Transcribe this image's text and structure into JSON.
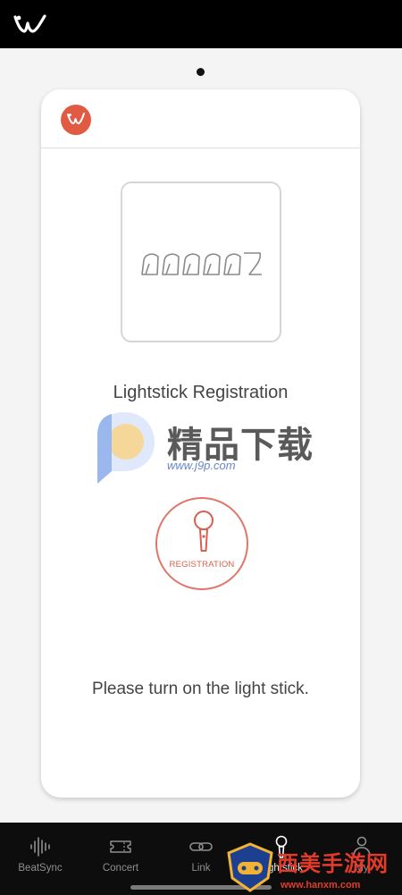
{
  "header": {
    "logo_icon": "weverse-logo-icon"
  },
  "card": {
    "title": "Lightstick Registration",
    "artist_logo_text": "ccccdz",
    "registration_button_label": "REGISTRATION",
    "hint": "Please turn on the light stick."
  },
  "watermark": {
    "text": "精品下载",
    "url": "www.j9p.com"
  },
  "corner_watermark": {
    "text": "西美手游网",
    "url": "www.hanxm.com"
  },
  "bottom_nav": [
    {
      "label": "BeatSync",
      "icon": "soundwave-icon"
    },
    {
      "label": "Concert",
      "icon": "ticket-icon"
    },
    {
      "label": "Link",
      "icon": "link-icon"
    },
    {
      "label": "Lightstick",
      "icon": "lightstick-icon"
    },
    {
      "label": "My",
      "icon": "person-icon"
    }
  ],
  "colors": {
    "accent": "#e15b44",
    "topbar": "#000000",
    "nav_bg": "#0d0d0d"
  }
}
